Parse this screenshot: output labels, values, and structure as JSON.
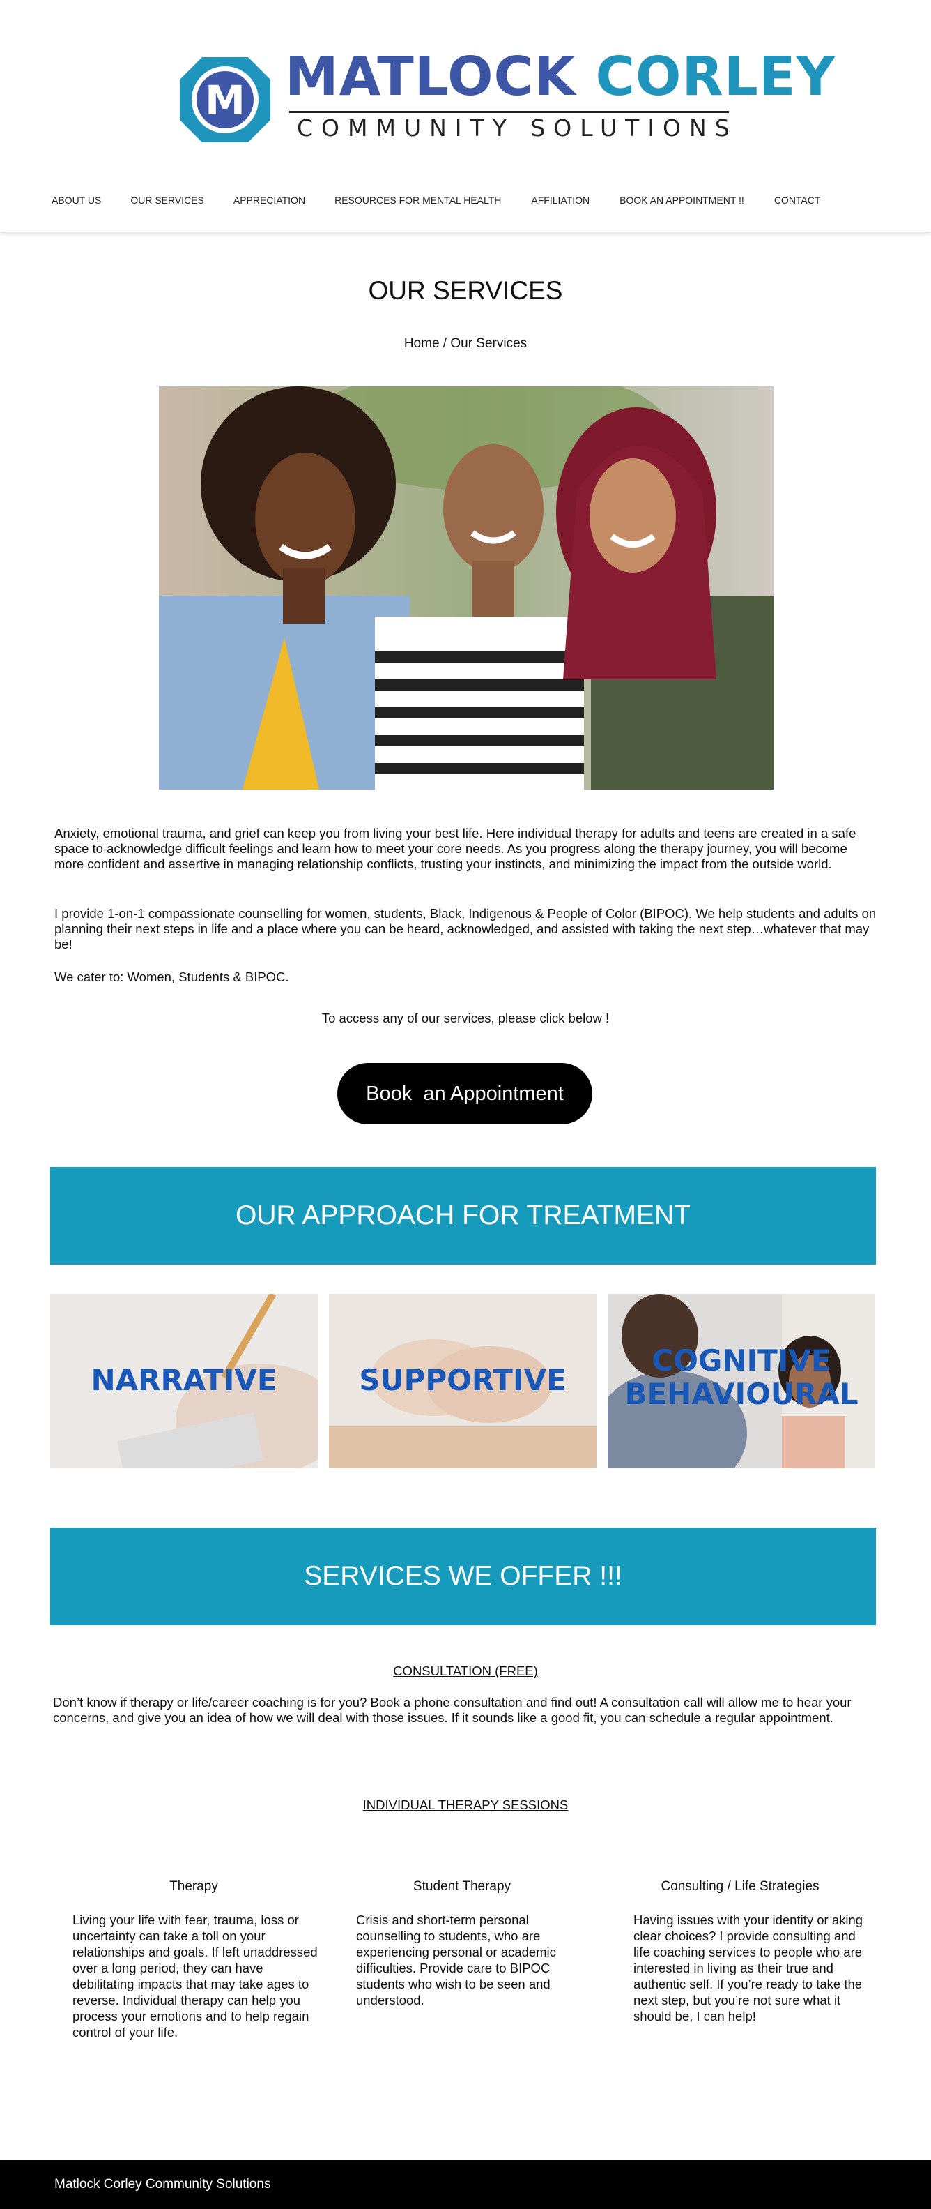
{
  "brand": {
    "name_part1": "MATLOCK",
    "name_part2": "CORLEY",
    "subtitle": "COMMUNITY SOLUTIONS",
    "logo_letter": "M",
    "colors": {
      "primary_blue": "#3d56a6",
      "teal": "#1f95bd"
    }
  },
  "nav": {
    "items": [
      {
        "label": "ABOUT US"
      },
      {
        "label": "OUR SERVICES"
      },
      {
        "label": "APPRECIATION"
      },
      {
        "label": "RESOURCES FOR MENTAL HEALTH"
      },
      {
        "label": "AFFILIATION"
      },
      {
        "label": "BOOK AN APPOINTMENT !!"
      },
      {
        "label": "CONTACT"
      }
    ]
  },
  "page": {
    "title": "OUR SERVICES",
    "breadcrumb_home": "Home",
    "breadcrumb_sep": " / ",
    "breadcrumb_current": "Our Services"
  },
  "intro": {
    "p1": "Anxiety, emotional trauma, and grief can keep you from living your best life. Here individual therapy for adults and teens are created in a safe space to acknowledge difficult feelings and learn how to meet your core needs. As you progress along the therapy journey, you will become more confident and assertive in managing relationship conflicts, trusting your instincts, and minimizing the impact from the outside world.",
    "p2": "I provide 1-on-1 compassionate counselling for women, students, Black, Indigenous & People of Color (BIPOC). We help students and adults on planning their next steps in life and a place where you can be heard, acknowledged, and assisted with taking the next step…whatever that may be!",
    "p3": "We cater to: Women, Students & BIPOC.",
    "access": "To access any of our services, please click below !"
  },
  "cta": {
    "book_label": "Book  an Appointment"
  },
  "approach": {
    "heading": "OUR APPROACH FOR TREATMENT",
    "tiles": [
      {
        "label": "NARRATIVE"
      },
      {
        "label": "SUPPORTIVE"
      },
      {
        "label_line1": "COGNITIVE",
        "label_line2": "BEHAVIOURAL"
      }
    ],
    "band_color": "#169bbd"
  },
  "services": {
    "heading": "SERVICES WE OFFER !!!",
    "consultation_title": "CONSULTATION (FREE)",
    "consultation_text": "Don’t know if therapy or life/career coaching is for you? Book a phone consultation and find out! A consultation call will allow me to hear your concerns, and give you an idea of how we will deal with those issues. If it sounds like a good fit, you can schedule a regular appointment.",
    "individual_title": "INDIVIDUAL THERAPY SESSIONS",
    "columns": [
      {
        "title": "Therapy",
        "text": "Living your life with fear, trauma, loss or uncertainty can take a toll on your relationships and goals. If left unaddressed over a long period, they can have debilitating impacts that may take ages to reverse. Individual therapy can help you process your emotions and to help regain control of your life."
      },
      {
        "title": "Student Therapy",
        "text": "Crisis and short-term personal counselling to students, who are experiencing personal or academic difficulties. Provide care to BIPOC students who wish to be seen and understood."
      },
      {
        "title": "Consulting / Life Strategies",
        "text": "Having issues with your identity or aking clear choices? I provide consulting and life coaching services to people who are interested in living as their true and authentic self. If you’re ready to take the next step, but you’re not sure what it should be, I can help!"
      }
    ]
  },
  "footer": {
    "text": "Matlock Corley Community Solutions"
  }
}
